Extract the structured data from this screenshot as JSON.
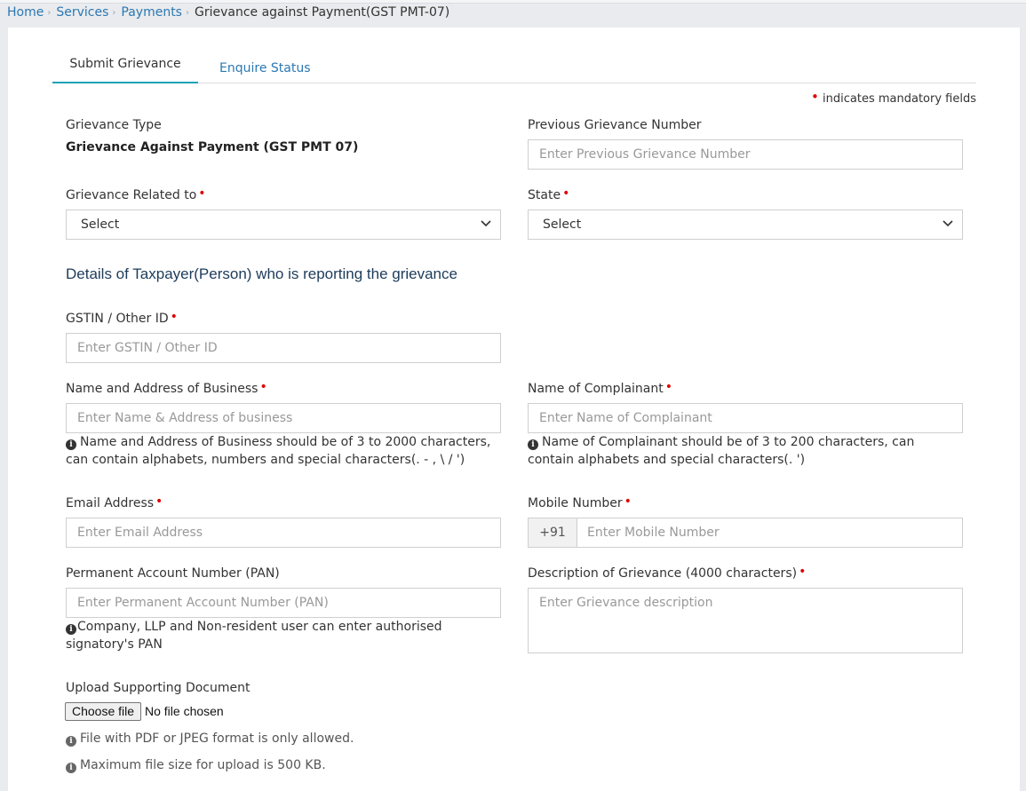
{
  "breadcrumb": {
    "home": "Home",
    "services": "Services",
    "payments": "Payments",
    "current": "Grievance against Payment(GST PMT-07)",
    "separator": "›"
  },
  "tabs": {
    "submit": "Submit Grievance",
    "enquire": "Enquire Status"
  },
  "mandatory_note": "indicates mandatory fields",
  "required_marker": "•",
  "form": {
    "grievance_type": {
      "label": "Grievance Type",
      "value": "Grievance Against Payment (GST PMT 07)"
    },
    "previous_number": {
      "label": "Previous Grievance Number",
      "placeholder": "Enter Previous Grievance Number"
    },
    "related_to": {
      "label": "Grievance Related to",
      "selected": "Select"
    },
    "state": {
      "label": "State",
      "selected": "Select"
    },
    "section_title": "Details of Taxpayer(Person) who is reporting the grievance",
    "gstin": {
      "label": "GSTIN / Other ID",
      "placeholder": "Enter GSTIN / Other ID"
    },
    "business": {
      "label": "Name and Address of Business",
      "placeholder": "Enter Name & Address of business",
      "help_line1": "Name and Address of Business should be of 3 to 2000 characters,",
      "help_line2": "can contain alphabets, numbers and special characters(. - , \\ / ')"
    },
    "complainant": {
      "label": "Name of Complainant",
      "placeholder": "Enter Name of Complainant",
      "help_line1": "Name of Complainant should be of 3 to 200 characters, can",
      "help_line2": "contain alphabets and special characters(. ')"
    },
    "email": {
      "label": "Email Address",
      "placeholder": "Enter Email Address"
    },
    "mobile": {
      "label": "Mobile Number",
      "prefix": "+91",
      "placeholder": "Enter Mobile Number"
    },
    "pan": {
      "label": "Permanent Account Number (PAN)",
      "placeholder": "Enter Permanent Account Number (PAN)",
      "help_line1": "Company, LLP and Non-resident user can enter authorised",
      "help_line2": "signatory's PAN"
    },
    "description": {
      "label": "Description of Grievance (4000 characters)",
      "placeholder": "Enter Grievance description"
    },
    "upload": {
      "label": "Upload Supporting Document",
      "button": "Choose file",
      "status": "No file chosen",
      "help_format": "File with PDF or JPEG format is only allowed.",
      "help_size": "Maximum file size for upload is 500 KB."
    }
  },
  "icons": {
    "info": "i"
  },
  "colors": {
    "link": "#2c78b2",
    "required": "#e00000",
    "tab_active": "#17a2b8",
    "section_title": "#1d3b5a"
  }
}
